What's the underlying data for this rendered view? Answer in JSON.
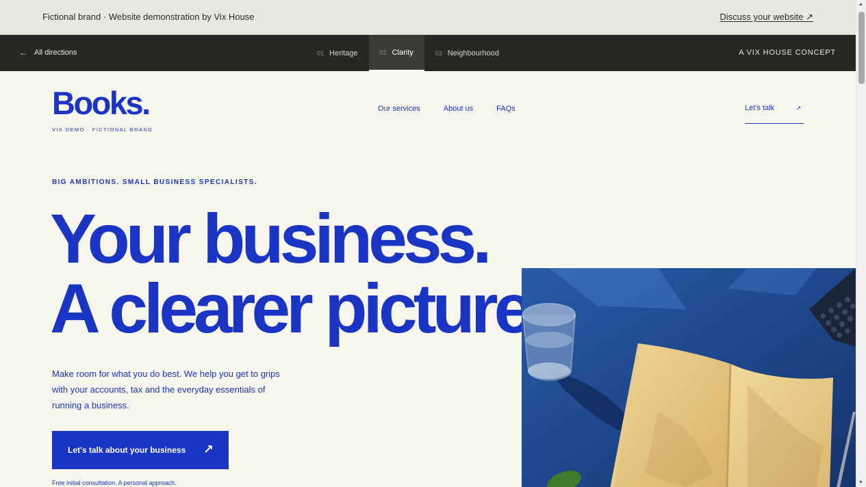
{
  "topbar": {
    "brand_text": "Fictional brand · Website demonstration by Vix House",
    "discuss_link": "Discuss your website ↗"
  },
  "dark_nav": {
    "back_label": "All directions",
    "tabs": [
      {
        "num": "01",
        "label": "Heritage"
      },
      {
        "num": "02",
        "label": "Clarity"
      },
      {
        "num": "03",
        "label": "Neighbourhood"
      }
    ],
    "active_tab": "Clarity",
    "concept_label": "A VIX HOUSE CONCEPT"
  },
  "header": {
    "logo": "Books.",
    "logo_sub": "VIX DEMO · FICTIONAL BRAND",
    "nav": [
      "Our services",
      "About us",
      "FAQs"
    ],
    "talk_label": "Let's talk",
    "talk_arrow": "↗"
  },
  "hero": {
    "eyebrow": "BIG AMBITIONS. SMALL BUSINESS SPECIALISTS.",
    "headline_line1": "Your business.",
    "headline_line2": "A clearer picture.",
    "lede": "Make room for what you do best. We help you get to grips with your accounts, tax and the everyday essentials of running a business.",
    "cta_label": "Let's talk about your business",
    "cta_arrow": "↗",
    "footnote": "Free initial consultation. A personal approach."
  },
  "colors": {
    "brand_blue": "#1a35c4",
    "cream_bg": "#f6f5ee",
    "top_strip_bg": "#e8e9dd",
    "dark_nav_bg": "#262823"
  }
}
